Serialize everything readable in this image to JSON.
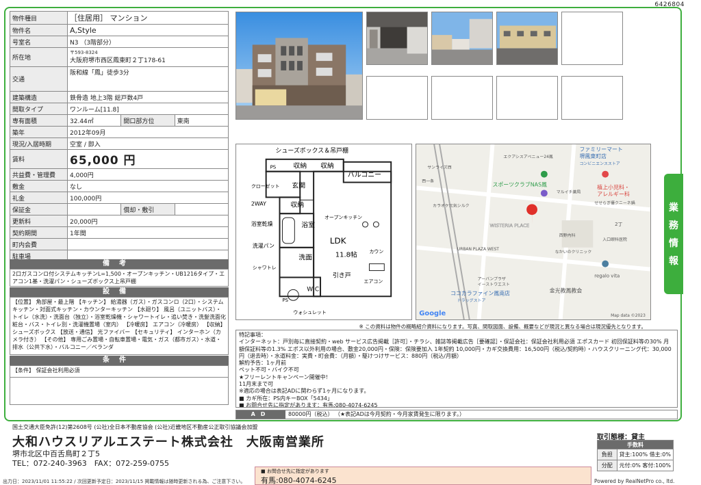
{
  "page_id": "6426804",
  "side_tab": [
    "業",
    "務",
    "情",
    "報"
  ],
  "info": {
    "type_label": "物件種目",
    "type_value": "［住居用］ マンション",
    "name_label": "物件名",
    "name_value": "A,Style",
    "room_label": "号室名",
    "room_value": "N3 （3階部分）",
    "addr_label": "所在地",
    "addr_zip": "〒593-8324",
    "addr_value": "大阪府堺市西区鳳東町２丁178-61",
    "traffic_label": "交通",
    "traffic_value": "阪和線「鳳」徒歩3分",
    "structure_label": "建築構造",
    "structure_value": "鉄骨造 地上3階 総戸数4戸",
    "layout_label": "間取タイプ",
    "layout_value": "ワンルーム[11.8]",
    "area_label": "専有面積",
    "area_value": "32.44㎡",
    "direction_label": "開口部方位",
    "direction_value": "東南",
    "built_label": "築年",
    "built_value": "2012年09月",
    "status_label": "現況/入居時期",
    "status_value": "空室 / 即入",
    "rent_label": "賃料",
    "rent_value": "65,000 円",
    "common_label": "共益費・管理費",
    "common_value": "4,000円",
    "deposit_label": "敷金",
    "deposit_value": "なし",
    "key_label": "礼金",
    "key_value": "100,000円",
    "guarantee_label": "保証金",
    "guarantee_value": "",
    "amort_label": "償却・敷引",
    "amort_value": "",
    "renewal_label": "更新料",
    "renewal_value": "20,000円",
    "contract_label": "契約期間",
    "contract_value": "1年間",
    "town_label": "町内会費",
    "town_value": "",
    "parking_label": "駐車場",
    "parking_value": ""
  },
  "remarks": {
    "title": "備考",
    "text": "2口ガスコンロ付システムキッチンL=1,500・オープンキッチン・UB1216タイプ・エアコン1基・洗濯パン・シューズボックス上吊戸棚"
  },
  "equipment": {
    "title": "設備",
    "text": "【位置】 角部屋・最上階 【キッチン】 給湯器（ガス）・ガスコンロ（2口）・システムキッチン・対面式キッチン・カウンターキッチン 【水廻り】 風呂（ユニットバス）・トイレ（水洗）・洗面台（独立）・浴室乾燥機・シャワートイレ・追い焚き・洗髪洗面化粧台・バス・トイレ別・洗濯機置場（室内） 【冷暖房】 エアコン（冷暖房） 【収納】 シューズボックス 【放送・通信】 光ファイバー 【セキュリティ】 インターホン（カメラ付き） 【その他】 専用ごみ置場・自転車置場・電気・ガス（都市ガス）・水道・排水（公共下水）・バルコニー／ベランダ"
  },
  "conditions": {
    "title": "条件",
    "text": "【条件】 保証会社利用必須"
  },
  "floorplan": {
    "top_label": "シューズボックス＆吊戸棚",
    "ps1": "PS",
    "storage1": "収納",
    "storage2": "収納",
    "balcony": "バルコニー",
    "closet": "クローゼット",
    "closet2": "2WAY",
    "entrance": "玄関",
    "storage3": "収納",
    "bath_dry": "浴室乾燥",
    "bath": "浴室",
    "open_kitchen": "オープンキッチン",
    "ldk": "LDK",
    "ldk_size": "11.8帖",
    "kaun": "カウン",
    "washpan": "洗濯パン",
    "washroom": "洗面",
    "shower": "シャワトレ",
    "sliding": "引き戸",
    "aircon": "エアコン",
    "ps2": "PS",
    "wc": "W C",
    "washlet": "ウォシュレット"
  },
  "map": {
    "labels": [
      "ファミリーマート",
      "堺鳳東町店",
      "コンビニエンスストア",
      "サンライズ西",
      "エクアシスアベニュー24鳳",
      "スポーツクラブNAS鳳",
      "植上小児科・",
      "アレルギー科",
      "西一条",
      "マルイチ薬局",
      "せせらぎ優クニーネ鍋",
      "カラオケ元気シルク",
      "WISTERIA PLACE",
      "2丁",
      "西野内科",
      "入口眼科医院",
      "URBAN PLAZA WEST",
      "なかいのクリニック",
      "アーバンプラザ",
      "イーストウエスト",
      "ココカラファイン鳳南店",
      "ドラッグストア",
      "金光教鳳教会",
      "regalo vita"
    ],
    "google": "Google",
    "copyright": "Map data ©2023"
  },
  "note": "※ この資料は物件の概略紹介資料になります。写真、間取図面、設備、概要などが現況と異なる場合は現況優先となります。",
  "features": [
    "特記事項：",
    "インターネット：戸別毎に直接契約・web サービス広告掲載［許可］・チラシ、雑誌等掲載広告［要確認］・保証会社：保証会社利用必須 エポスカード 初回保証料等の30% 月額保証料等の1.3% エポス以外利用の場合、敷金20,000円・保険：保険要加入 1年契約 10,000円・カギ交換費用：16,500円（税込/契約時）・ハウスクリーニング代：30,000円（退去時）・水道料金：実費・町会費：（月額）・駆けつけサービス：880円（税込/月額）",
    "解約予告：1ヶ月前",
    "ペット不可・バイク不可",
    "★フリーレントキャンペーン開催中!",
    "11月末まで可",
    "※適応の場合は表記ADに関わらず1ヶ月になります。",
    "■ カギ所在：PS内キーBOX「5434」",
    "■ お問合せ先に指定があります：有馬:080-4074-6245"
  ],
  "ad": {
    "label": "AD",
    "value": "80000円（税込） （★表記ADは今月契約・今月家賃発生に限ります。）"
  },
  "footer": {
    "license": "国土交通大臣免許(12)第2608号 (公社)全日本不動産協会 (公社)近畿地区不動産公正取引協議会加盟",
    "company": "大和ハウスリアルエステート株式会社　大阪南営業所",
    "address": "堺市北区中百舌鳥町２丁5",
    "tel": "TEL：072-240-3963　FAX：072-259-0755",
    "output": "出力日：2023/11/01 11:55:22 / 次回更新予定日：2023/11/15 掲載情報は随時更新される為、ご注意下さい。",
    "powered": "Powered by RealNetPro co., ltd.",
    "contact_small": "■ お問合せ先に指定があります",
    "contact_large": "有馬:080-4074-6245",
    "deal_type": "取引態様：貸主",
    "fee_title": "手数料",
    "fee_burden_label": "負担",
    "fee_burden_value": "貸主:100% 借主:0%",
    "fee_split_label": "分配",
    "fee_split_value": "元付:0% 客付:100%"
  }
}
